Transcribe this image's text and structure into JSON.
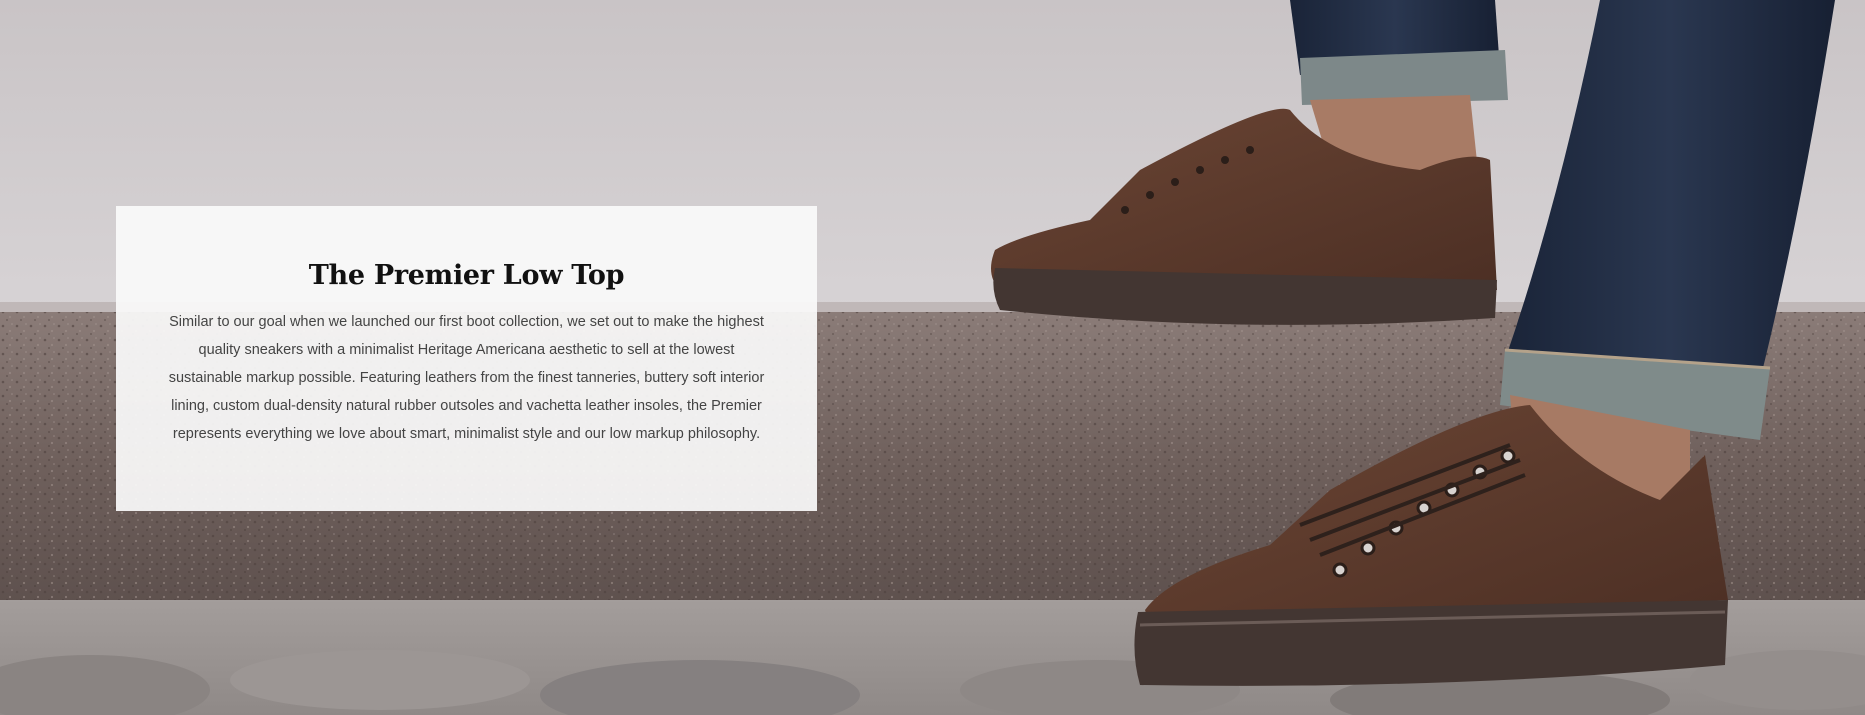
{
  "hero": {
    "image_description_icon": "sneakers-photo"
  },
  "card": {
    "title": "The Premier Low Top",
    "body": "Similar to our goal when we launched our first boot collection, we set out to make the highest quality sneakers with a minimalist Heritage Americana aesthetic to sell at the lowest sustainable markup possible. Featuring leathers from the finest tanneries, buttery soft interior lining, custom dual-density natural rubber outsoles and vachetta leather insoles, the Premier represents everything we love about smart, minimalist style and our low markup philosophy."
  },
  "colors": {
    "leather": "#5a3a2c",
    "sole": "#4a3a36",
    "denim": "#1f2a3d",
    "granite": "#7d6e6a",
    "pavement": "#d3cfd1"
  }
}
